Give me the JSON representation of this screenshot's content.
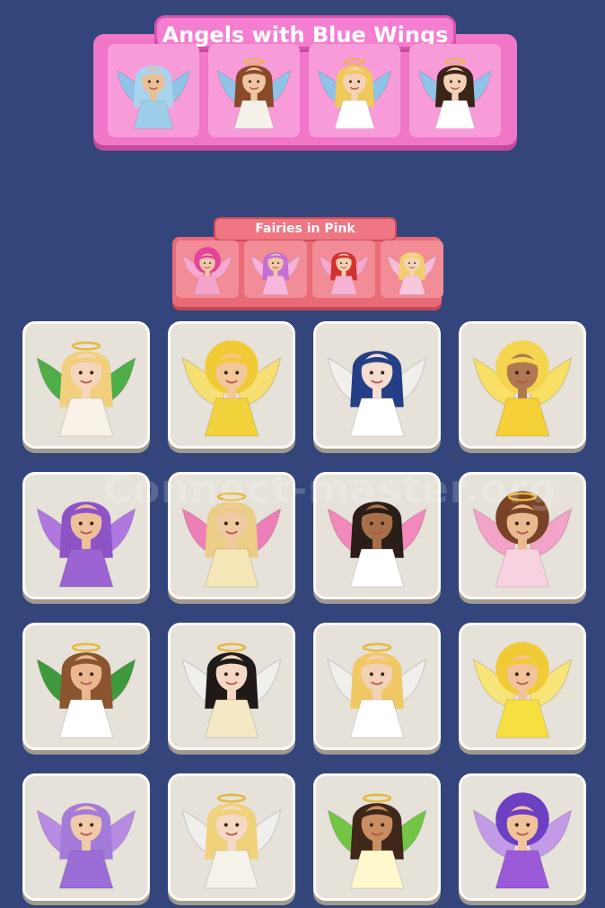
{
  "groups": [
    {
      "title": "Angels with Blue Wings",
      "members": [
        {
          "name": "blue-haired-angel",
          "hair": "#a9d4ee",
          "skin": "#e9bf97",
          "wing": "#8fc4e8",
          "dress": "#9dcde9",
          "halo": false,
          "curly": false
        },
        {
          "name": "brunette-angel",
          "hair": "#8a4a2a",
          "skin": "#efc5a2",
          "wing": "#8fc4e8",
          "dress": "#f4f1e8",
          "halo": true,
          "curly": false
        },
        {
          "name": "blonde-angel",
          "hair": "#f0c95a",
          "skin": "#f4d2b6",
          "wing": "#8fc4e8",
          "dress": "#ffffff",
          "halo": true,
          "curly": false
        },
        {
          "name": "male-angel",
          "hair": "#3a2418",
          "skin": "#f2d2b7",
          "wing": "#8fc4e8",
          "dress": "#ffffff",
          "halo": true,
          "curly": false
        }
      ]
    },
    {
      "title": "Fairies in Pink",
      "members": [
        {
          "name": "pink-haired-fairy",
          "hair": "#e4449a",
          "skin": "#f0c8a6",
          "wing": "#f6a8cf",
          "dress": "#f4a3cb",
          "halo": false,
          "curly": true
        },
        {
          "name": "lilac-fairy",
          "hair": "#c66fd6",
          "skin": "#f0c8a6",
          "wing": "#f4b4d8",
          "dress": "#f7b7dc",
          "halo": false,
          "curly": false
        },
        {
          "name": "redhead-fairy",
          "hair": "#d2322c",
          "skin": "#f2cfb2",
          "wing": "#f6a8cf",
          "dress": "#f5b2d2",
          "halo": false,
          "curly": false
        },
        {
          "name": "blonde-fairy",
          "hair": "#f0cf6c",
          "skin": "#f3d4ba",
          "wing": "#f6bcd8",
          "dress": "#f7c6dc",
          "halo": false,
          "curly": false
        }
      ]
    }
  ],
  "tiles": [
    {
      "name": "green-winged-angel",
      "hair": "#f1cf7c",
      "skin": "#f5d6bd",
      "wing": "#4fae47",
      "dress": "#f8f3e6",
      "halo": true,
      "curly": false
    },
    {
      "name": "curly-blonde-fairy",
      "hair": "#f1cb35",
      "skin": "#f2c79a",
      "wing": "#f6e073",
      "dress": "#f3d33b",
      "halo": false,
      "curly": true
    },
    {
      "name": "dark-blue-haired-angel",
      "hair": "#243f86",
      "skin": "#f5ddd0",
      "wing": "#f1efeb",
      "dress": "#ffffff",
      "halo": false,
      "curly": false
    },
    {
      "name": "yellow-fairy",
      "hair": "#f5d550",
      "skin": "#b07850",
      "wing": "#f8e066",
      "dress": "#f5d036",
      "halo": false,
      "curly": true
    },
    {
      "name": "purple-fairy",
      "hair": "#8e54c6",
      "skin": "#eebf9b",
      "wing": "#b078de",
      "dress": "#9c64d2",
      "halo": false,
      "curly": false
    },
    {
      "name": "pink-winged-angel",
      "hair": "#eccd86",
      "skin": "#f0c9a2",
      "wing": "#ee7fb6",
      "dress": "#f4e6b7",
      "halo": true,
      "curly": false
    },
    {
      "name": "pink-winged-bride-angel",
      "hair": "#2b1e18",
      "skin": "#a8704a",
      "wing": "#f189bc",
      "dress": "#ffffff",
      "halo": false,
      "curly": false
    },
    {
      "name": "pink-winged-curly-angel",
      "hair": "#7a4327",
      "skin": "#e9b98f",
      "wing": "#f3a2c8",
      "dress": "#f8d2df",
      "halo": true,
      "curly": true
    },
    {
      "name": "green-winged-male-angel",
      "hair": "#8b5530",
      "skin": "#e9b88e",
      "wing": "#3f9a3d",
      "dress": "#ffffff",
      "halo": true,
      "curly": false
    },
    {
      "name": "black-haired-angel",
      "hair": "#1f1a18",
      "skin": "#f4d8c5",
      "wing": "#f1efeb",
      "dress": "#f3e9c4",
      "halo": true,
      "curly": false
    },
    {
      "name": "mother-angel",
      "hair": "#f0c865",
      "skin": "#f3d1b7",
      "wing": "#f1efeb",
      "dress": "#ffffff",
      "halo": true,
      "curly": false
    },
    {
      "name": "yellow-curly-fairy",
      "hair": "#f1cb35",
      "skin": "#f0c39a",
      "wing": "#f7e57a",
      "dress": "#f6df41",
      "halo": false,
      "curly": true
    },
    {
      "name": "lavender-fairy",
      "hair": "#a27cd8",
      "skin": "#f0caa9",
      "wing": "#b78ce2",
      "dress": "#9a6ed6",
      "halo": false,
      "curly": false
    },
    {
      "name": "platinum-angel",
      "hair": "#f0d27b",
      "skin": "#f5d9c4",
      "wing": "#f1efeb",
      "dress": "#f5f2ea",
      "halo": true,
      "curly": false
    },
    {
      "name": "green-winged-boy-angel",
      "hair": "#3f2719",
      "skin": "#c88e62",
      "wing": "#73c645",
      "dress": "#fff8cc",
      "halo": true,
      "curly": false
    },
    {
      "name": "violet-curly-fairy",
      "hair": "#6d3fc3",
      "skin": "#f0c39a",
      "wing": "#c39ae6",
      "dress": "#9b5ad8",
      "halo": false,
      "curly": true
    }
  ],
  "watermark": "Connect-master.org"
}
